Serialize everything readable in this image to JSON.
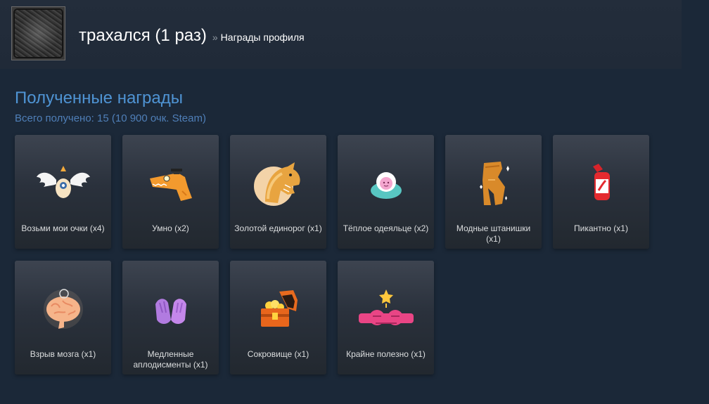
{
  "header": {
    "profile_name": "трахался (1 раз)",
    "separator": "»",
    "page_name": "Награды профиля"
  },
  "section": {
    "title": "Полученные награды",
    "subtitle": "Всего получено: 15 (10 900 очк. Steam)"
  },
  "awards": [
    {
      "label": "Возьми мои очки (x4)",
      "icon": "winged-coin-icon"
    },
    {
      "label": "Умно (x2)",
      "icon": "smart-dino-icon"
    },
    {
      "label": "Золотой единорог (x1)",
      "icon": "golden-unicorn-icon"
    },
    {
      "label": "Тёплое одеяльце (x2)",
      "icon": "warm-blanket-icon"
    },
    {
      "label": "Модные штанишки (x1)",
      "icon": "fancy-pants-icon"
    },
    {
      "label": "Пикантно (x1)",
      "icon": "hot-sauce-icon"
    },
    {
      "label": "Взрыв мозга (x1)",
      "icon": "brain-explode-icon"
    },
    {
      "label": "Медленные аплодисменты (x1)",
      "icon": "slow-clap-icon"
    },
    {
      "label": "Сокровище (x1)",
      "icon": "treasure-chest-icon"
    },
    {
      "label": "Крайне полезно (x1)",
      "icon": "very-helpful-icon"
    }
  ]
}
